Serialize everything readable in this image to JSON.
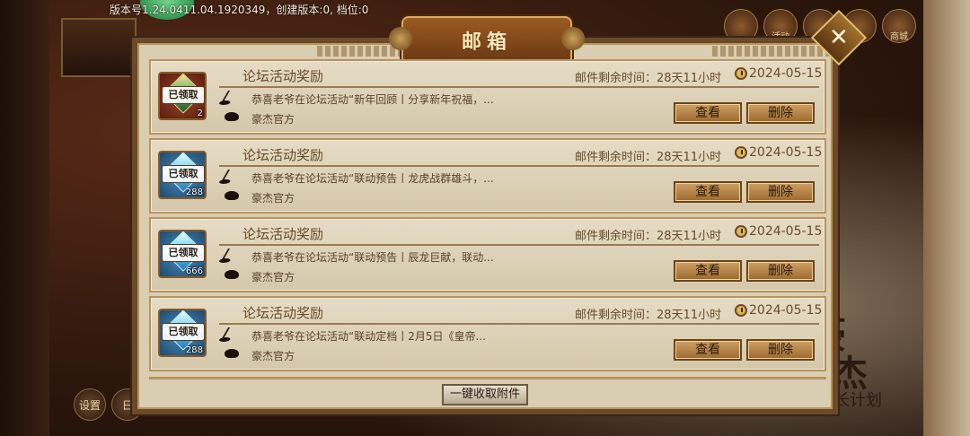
{
  "version_bar": {
    "text": "版本号1.24.0411.04.1920349，创建版本:0, 档位:0"
  },
  "background": {
    "top_icons": [
      "",
      "活动",
      "",
      "",
      "商城"
    ],
    "bottom_left_buttons": [
      "设置",
      "日"
    ],
    "calligraphy": {
      "line1": "豪",
      "line2": "杰",
      "line3": "成长计划"
    }
  },
  "dialog": {
    "title": "邮箱",
    "close_glyph": "✕",
    "collect_all_label": "一键收取附件",
    "mails": [
      {
        "title": "论坛活动奖励",
        "remaining": "邮件剩余时间：28天11小时",
        "date": "2024-05-15",
        "description": "恭喜老爷在论坛活动“新年回顾丨分享新年祝福，...",
        "sender": "豪杰官方",
        "claimed_label": "已领取",
        "quantity": "2",
        "icon": "green-item-icon",
        "view_label": "查看",
        "delete_label": "删除"
      },
      {
        "title": "论坛活动奖励",
        "remaining": "邮件剩余时间：28天11小时",
        "date": "2024-05-15",
        "description": "恭喜老爷在论坛活动“联动预告丨龙虎战群雄斗，...",
        "sender": "豪杰官方",
        "claimed_label": "已领取",
        "quantity": "288",
        "icon": "diamond-icon",
        "view_label": "查看",
        "delete_label": "删除"
      },
      {
        "title": "论坛活动奖励",
        "remaining": "邮件剩余时间：28天11小时",
        "date": "2024-05-15",
        "description": "恭喜老爷在论坛活动“联动预告丨辰龙巨献，联动...",
        "sender": "豪杰官方",
        "claimed_label": "已领取",
        "quantity": "666",
        "icon": "diamond-icon",
        "view_label": "查看",
        "delete_label": "删除"
      },
      {
        "title": "论坛活动奖励",
        "remaining": "邮件剩余时间：28天11小时",
        "date": "2024-05-15",
        "description": "恭喜老爷在论坛活动“联动定档丨2月5日《皇帝...",
        "sender": "豪杰官方",
        "claimed_label": "已领取",
        "quantity": "288",
        "icon": "diamond-icon",
        "view_label": "查看",
        "delete_label": "删除"
      }
    ]
  },
  "colors": {
    "frame": "#6b4a2a",
    "panel": "#d9cdb2",
    "text_brown": "#6a4a2a",
    "button": "#cfa064"
  }
}
